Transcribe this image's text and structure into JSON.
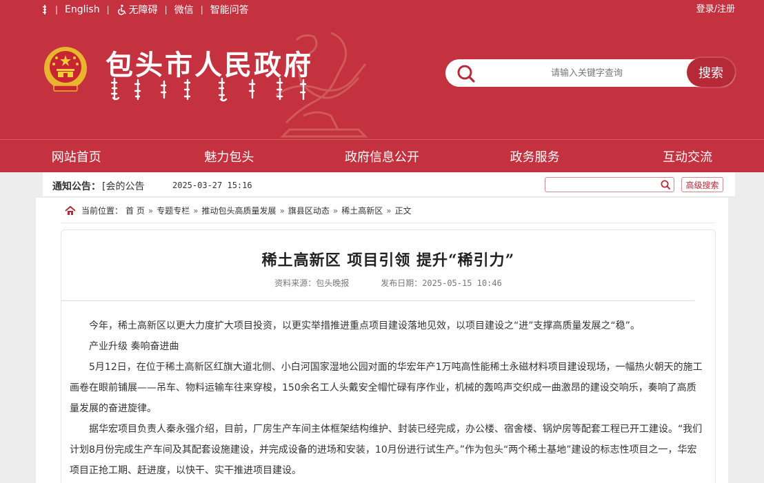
{
  "topbar": {
    "english": "English",
    "accessible": "无障碍",
    "wechat": "微信",
    "qa": "智能问答",
    "login": "登录/注册"
  },
  "header": {
    "title": "包头市人民政府"
  },
  "search": {
    "placeholder": "请输入关键字查询",
    "button": "搜索"
  },
  "nav": [
    "网站首页",
    "魅力包头",
    "政府信息公开",
    "政务服务",
    "互动交流"
  ],
  "notice": {
    "label": "通知公告：",
    "text": "[会的公告",
    "date": "2025-03-27 15:16",
    "advanced_search": "高级搜索"
  },
  "breadcrumb": [
    "当前位置：",
    "首 页",
    "专题专栏",
    "推动包头高质量发展",
    "旗县区动态",
    "稀土高新区",
    "正文"
  ],
  "article": {
    "title": "稀土高新区 项目引领 提升“稀引力”",
    "source": "资料来源：包头晚报",
    "date": "发布日期：2025-05-15 10:46",
    "paragraphs": [
      "今年，稀土高新区以更大力度扩大项目投资，以更实举措推进重点项目建设落地见效，以项目建设之“进”支撑高质量发展之“稳”。",
      "产业升级 奏响奋进曲",
      "5月12日，在位于稀土高新区红旗大道北侧、小白河国家湿地公园对面的华宏年产1万吨高性能稀土永磁材料项目建设现场，一幅热火朝天的施工画卷在眼前铺展——吊车、物料运输车往来穿梭，150余名工人头戴安全帽忙碌有序作业，机械的轰鸣声交织成一曲激昂的建设交响乐，奏响了高质量发展的奋进旋律。",
      "据华宏项目负责人秦永强介绍，目前，厂房生产车间主体框架结构维护、封装已经完成，办公楼、宿舍楼、锅炉房等配套工程已开工建设。“我们计划8月份完成生产车间及其配套设施建设，并完成设备的进场和安装，10月份进行试生产。”作为包头“两个稀土基地”建设的标志性项目之一，华宏项目正抢工期、赶进度，以快干、实干推进项目建设。"
    ]
  },
  "colors": {
    "brand_red": "#c4313f",
    "button_red": "#b62a37"
  }
}
